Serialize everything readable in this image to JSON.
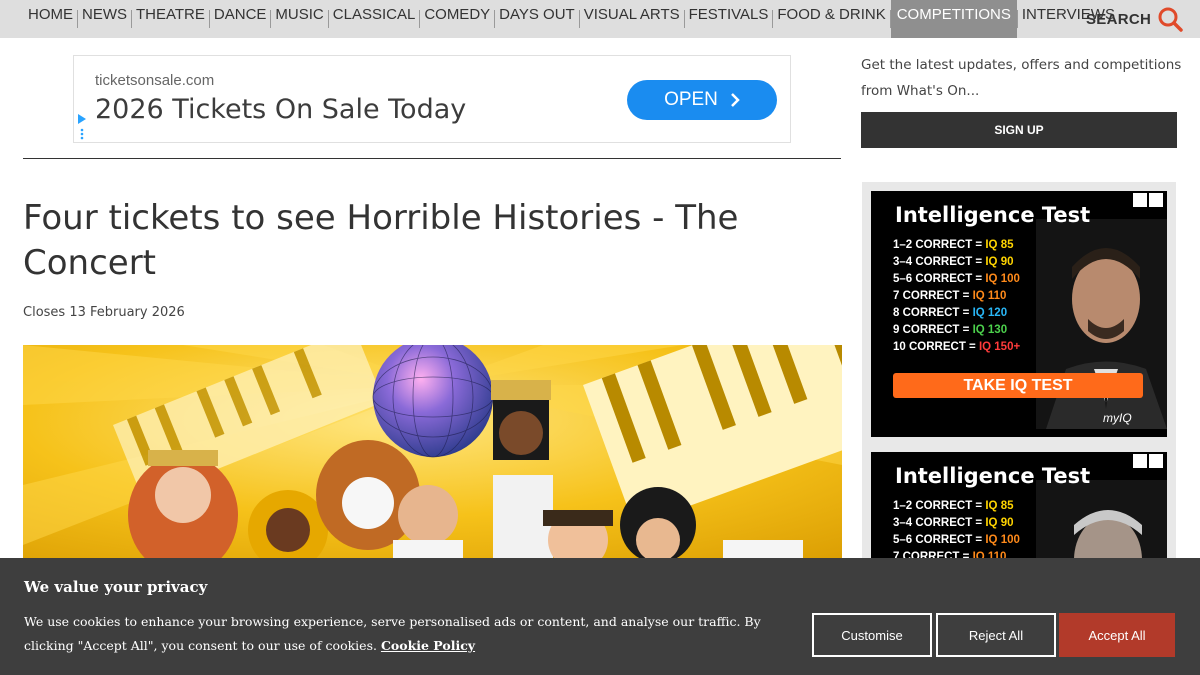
{
  "nav": {
    "items": [
      {
        "label": "HOME"
      },
      {
        "label": "NEWS"
      },
      {
        "label": "THEATRE"
      },
      {
        "label": "DANCE"
      },
      {
        "label": "MUSIC"
      },
      {
        "label": "CLASSICAL"
      },
      {
        "label": "COMEDY"
      },
      {
        "label": "DAYS OUT"
      },
      {
        "label": "VISUAL ARTS"
      },
      {
        "label": "FESTIVALS"
      },
      {
        "label": "FOOD & DRINK"
      },
      {
        "label": "COMPETITIONS",
        "active": true
      },
      {
        "label": "INTERVIEWS"
      }
    ],
    "search_label": "SEARCH",
    "accent_color": "#e04a2a"
  },
  "ad_banner": {
    "domain": "ticketsonsale.com",
    "headline": "2026 Tickets On Sale Today",
    "button_label": "OPEN",
    "button_color": "#1a8cf0"
  },
  "article": {
    "title": "Four tickets to see Horrible Histories - The Concert",
    "closes": "Closes 13 February 2026"
  },
  "sidebar": {
    "newsletter_text": "Get the latest updates, offers and competitions from What's On...",
    "signup_label": "SIGN UP",
    "iq_ads": [
      {
        "title": "Intelligence Test",
        "rows": [
          {
            "label": "1–2 CORRECT = ",
            "iq": "IQ 85",
            "color": "#ffd400"
          },
          {
            "label": "3–4 CORRECT = ",
            "iq": "IQ 90",
            "color": "#ffd400"
          },
          {
            "label": "5–6 CORRECT = ",
            "iq": "IQ 100",
            "color": "#ff8a1a"
          },
          {
            "label": "7 CORRECT = ",
            "iq": "IQ 110",
            "color": "#ff8a1a"
          },
          {
            "label": "8 CORRECT = ",
            "iq": "IQ 120",
            "color": "#29b6f6"
          },
          {
            "label": "9 CORRECT = ",
            "iq": "IQ 130",
            "color": "#4cd04c"
          },
          {
            "label": "10 CORRECT = ",
            "iq": "IQ 150+",
            "color": "#ff3b3b"
          }
        ],
        "cta": "TAKE IQ TEST",
        "brand": "myIQ"
      },
      {
        "title": "Intelligence Test",
        "rows": [
          {
            "label": "1–2 CORRECT = ",
            "iq": "IQ 85",
            "color": "#ffd400"
          },
          {
            "label": "3–4 CORRECT = ",
            "iq": "IQ 90",
            "color": "#ffd400"
          },
          {
            "label": "5–6 CORRECT = ",
            "iq": "IQ 100",
            "color": "#ff8a1a"
          },
          {
            "label": "7 CORRECT = ",
            "iq": "IQ 110",
            "color": "#ff8a1a"
          }
        ]
      }
    ]
  },
  "cookie": {
    "title": "We value your privacy",
    "text": "We use cookies to enhance your browsing experience, serve personalised ads or content, and analyse our traffic. By clicking \"Accept All\", you consent to our use of cookies.",
    "link_label": "Cookie Policy",
    "customise_label": "Customise",
    "reject_label": "Reject All",
    "accept_label": "Accept All",
    "accept_color": "#b23a2a"
  }
}
